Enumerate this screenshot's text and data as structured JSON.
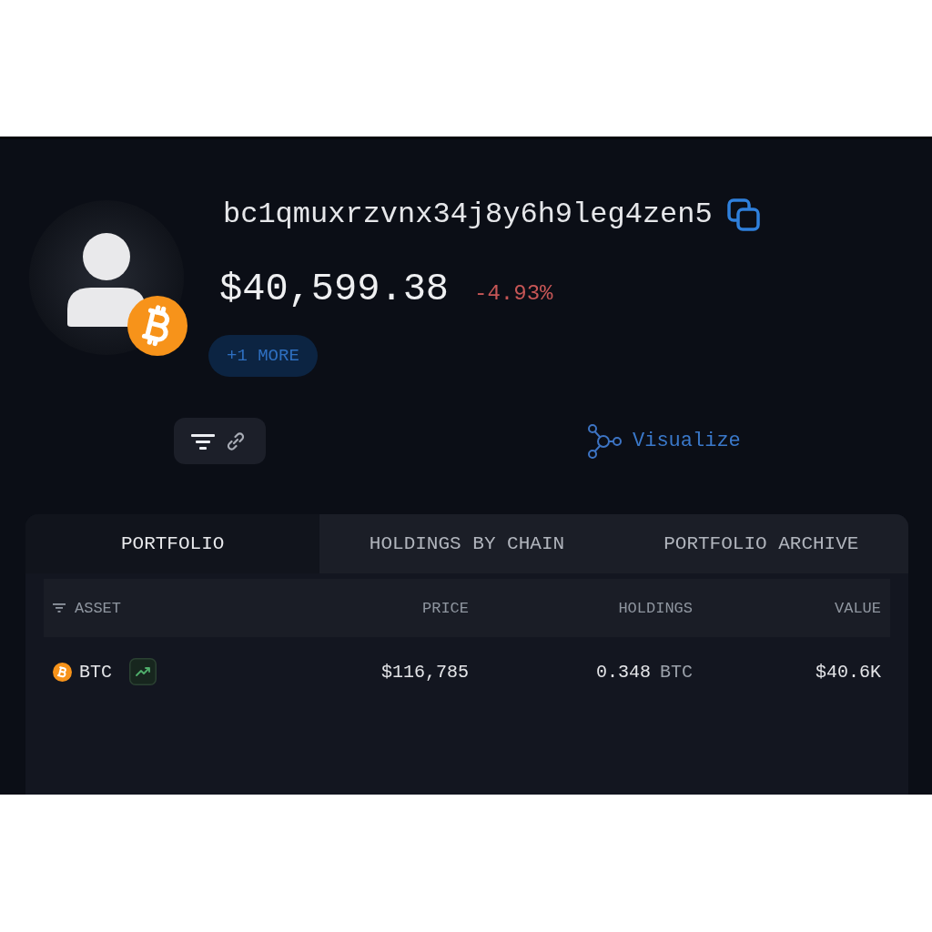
{
  "profile": {
    "address": "bc1qmuxrzvnx34j8y6h9leg4zen5",
    "balance": "$40,599.38",
    "change": "-4.93%",
    "change_negative": true,
    "more_button": "+1 MORE"
  },
  "actions": {
    "visualize_link": "Visualize"
  },
  "tabs": [
    {
      "label": "PORTFOLIO",
      "selected": true
    },
    {
      "label": "HOLDINGS BY CHAIN",
      "selected": false
    },
    {
      "label": "PORTFOLIO ARCHIVE",
      "selected": false
    }
  ],
  "table": {
    "columns": [
      {
        "label": "ASSET",
        "kind": "filter"
      },
      {
        "label": "PRICE",
        "kind": "plain"
      },
      {
        "label": "HOLDINGS",
        "kind": "plain"
      },
      {
        "label": "VALUE",
        "kind": "plain"
      }
    ],
    "rows": [
      {
        "asset": "BTC",
        "trending_up": true,
        "price": "$116,785",
        "holdings": "0.348",
        "holdings_unit": "BTC",
        "value": "$40.6K"
      }
    ]
  }
}
